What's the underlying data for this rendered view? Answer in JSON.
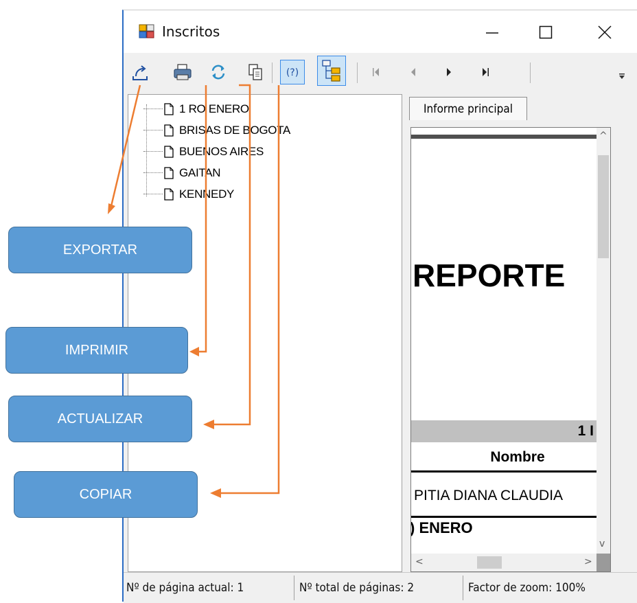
{
  "window": {
    "title": "Inscritos",
    "caption_buttons": [
      "minimize-icon",
      "maximize-icon",
      "close-icon"
    ]
  },
  "toolbar": {
    "buttons": [
      "export-icon",
      "print-icon",
      "refresh-icon",
      "copy-icon",
      "help-icon",
      "tree-toggle-icon",
      "first-page-icon",
      "previous-page-icon",
      "next-page-icon",
      "last-page-icon"
    ],
    "overflow": "chevron-down-icon"
  },
  "tree": {
    "items": [
      {
        "label": "1 RO ENERO"
      },
      {
        "label": "BRISAS DE BOGOTA"
      },
      {
        "label": "BUENOS AIRES"
      },
      {
        "label": "GAITAN"
      },
      {
        "label": "KENNEDY"
      }
    ]
  },
  "viewer": {
    "tab": "Informe principal",
    "report_title": "REPORTE",
    "group_band": "1 I",
    "column_header": "Nombre",
    "row1": "PITIA DIANA CLAUDIA",
    "row2": ") ENERO"
  },
  "status": {
    "current_page": "Nº de página actual: 1",
    "total_pages": "Nº total de páginas: 2",
    "zoom": "Factor de zoom: 100%"
  },
  "callouts": {
    "exportar": "EXPORTAR",
    "imprimir": "IMPRIMIR",
    "actualizar": "ACTUALIZAR",
    "copiar": "COPIAR"
  },
  "colors": {
    "callout_fill": "#5b9bd5",
    "arrow": "#ed7d31",
    "window_border": "#2b6cc4"
  }
}
